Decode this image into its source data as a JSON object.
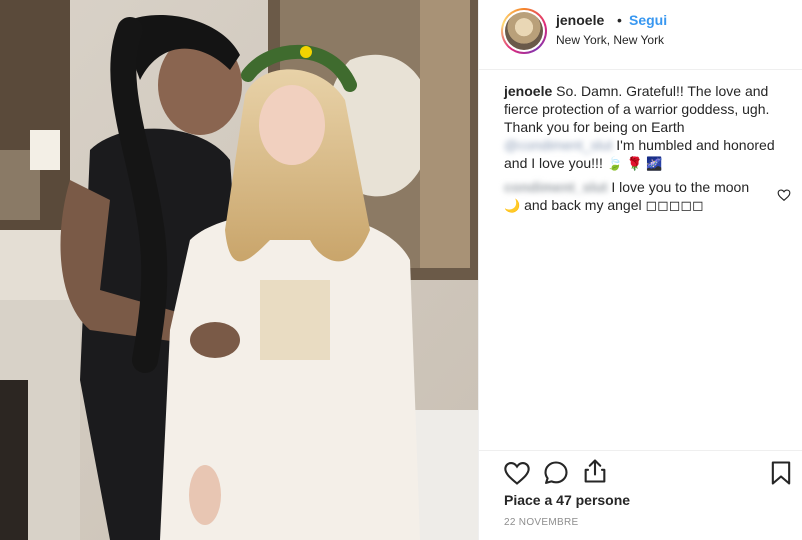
{
  "post": {
    "username": "jenoele",
    "separator": "•",
    "follow_label": "Segui",
    "location": "New York, New York"
  },
  "caption": {
    "username": "jenoele",
    "text_1": "So. Damn. Grateful!! The love and fierce protection of a warrior goddess, ugh. Thank you for being on Earth",
    "mention": "@condiment_slut",
    "text_2": "I'm humbled and honored and I love you!!!",
    "emojis": "🍃 🌹 🌌"
  },
  "comment": {
    "username": "condiment_slut",
    "text": "I love you to the moon",
    "emoji": "🌙",
    "text_2": "and back my angel ◻◻◻◻◻"
  },
  "likes": "Piace a 47 persone",
  "date": "22 NOVEMBRE",
  "icons": {
    "like": "heart-icon",
    "comment": "comment-icon",
    "share": "share-icon",
    "save": "bookmark-icon",
    "comment_like": "heart-icon"
  },
  "colors": {
    "link_blue": "#3897f0",
    "text": "#262626",
    "muted": "#8e8e8e"
  }
}
